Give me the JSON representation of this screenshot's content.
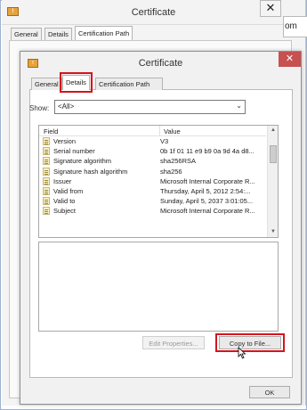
{
  "bg_window": {
    "title": "Certificate",
    "close_glyph": "✕",
    "app_icon_text": "!",
    "tabs": [
      "General",
      "Details",
      "Certification Path"
    ],
    "right_partial_text": "om"
  },
  "dialog": {
    "title": "Certificate",
    "close_glyph": "✕",
    "app_icon_text": "!",
    "tabs": [
      "General",
      "Details",
      "Certification Path"
    ],
    "active_tab": "Details",
    "show_label": "Show:",
    "show_value": "<All>",
    "columns": {
      "field": "Field",
      "value": "Value"
    },
    "rows": [
      {
        "field": "Version",
        "value": "V3"
      },
      {
        "field": "Serial number",
        "value": "0b 1f 01 11 e9 b9 0a 9d 4a d8..."
      },
      {
        "field": "Signature algorithm",
        "value": "sha256RSA"
      },
      {
        "field": "Signature hash algorithm",
        "value": "sha256"
      },
      {
        "field": "Issuer",
        "value": "Microsoft Internal Corporate R..."
      },
      {
        "field": "Valid from",
        "value": "Thursday, April 5, 2012 2:54:..."
      },
      {
        "field": "Valid to",
        "value": "Sunday, April 5, 2037 3:01:05..."
      },
      {
        "field": "Subject",
        "value": "Microsoft Internal Corporate R..."
      }
    ],
    "buttons": {
      "edit_properties": "Edit Properties...",
      "copy_to_file": "Copy to File...",
      "ok": "OK"
    }
  },
  "colors": {
    "highlight": "#d4151d",
    "close_button": "#c75050",
    "cert_icon": "#e6a23c"
  }
}
